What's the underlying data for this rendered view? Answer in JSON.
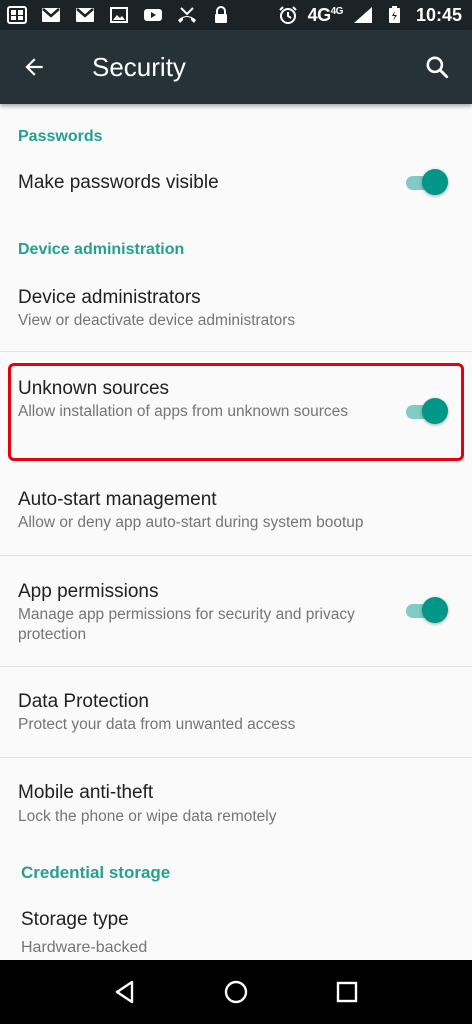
{
  "status_bar": {
    "left_icons": [
      "photo-grid-icon",
      "gmail-icon",
      "gmail-icon",
      "image-icon",
      "youtube-icon",
      "missed-call-icon",
      "lock-icon"
    ],
    "right_icons": [
      "alarm-icon",
      "signal-icon",
      "battery-icon"
    ],
    "network": "4G",
    "network_sup": "4G",
    "time": "10:45"
  },
  "app_bar": {
    "title": "Security",
    "background": "#263238"
  },
  "sections": {
    "passwords": {
      "label": "Passwords"
    },
    "device_admin": {
      "label": "Device administration"
    },
    "credential_storage": {
      "label": "Credential storage"
    }
  },
  "prefs": {
    "make_passwords_visible": {
      "title": "Make passwords visible",
      "switch_on": true
    },
    "device_administrators": {
      "title": "Device administrators",
      "summary": "View or deactivate device administrators"
    },
    "unknown_sources": {
      "title": "Unknown sources",
      "summary": "Allow installation of apps from unknown sources",
      "switch_on": true,
      "highlighted": true
    },
    "auto_start": {
      "title": "Auto-start management",
      "summary": "Allow or deny app auto-start during system bootup"
    },
    "app_permissions": {
      "title": "App permissions",
      "summary": "Manage app permissions for security and privacy protection",
      "switch_on": true
    },
    "data_protection": {
      "title": "Data Protection",
      "summary": "Protect your data from unwanted access"
    },
    "mobile_anti_theft": {
      "title": "Mobile anti-theft",
      "summary": "Lock the phone or wipe data remotely"
    },
    "storage_type": {
      "title": "Storage type",
      "summary": "Hardware-backed"
    }
  },
  "colors": {
    "accent": "#26a08f",
    "switch_thumb": "#009688",
    "highlight": "#e4000f"
  },
  "nav_bar": {
    "buttons": [
      "back-triangle-icon",
      "home-circle-icon",
      "recents-square-icon"
    ]
  }
}
